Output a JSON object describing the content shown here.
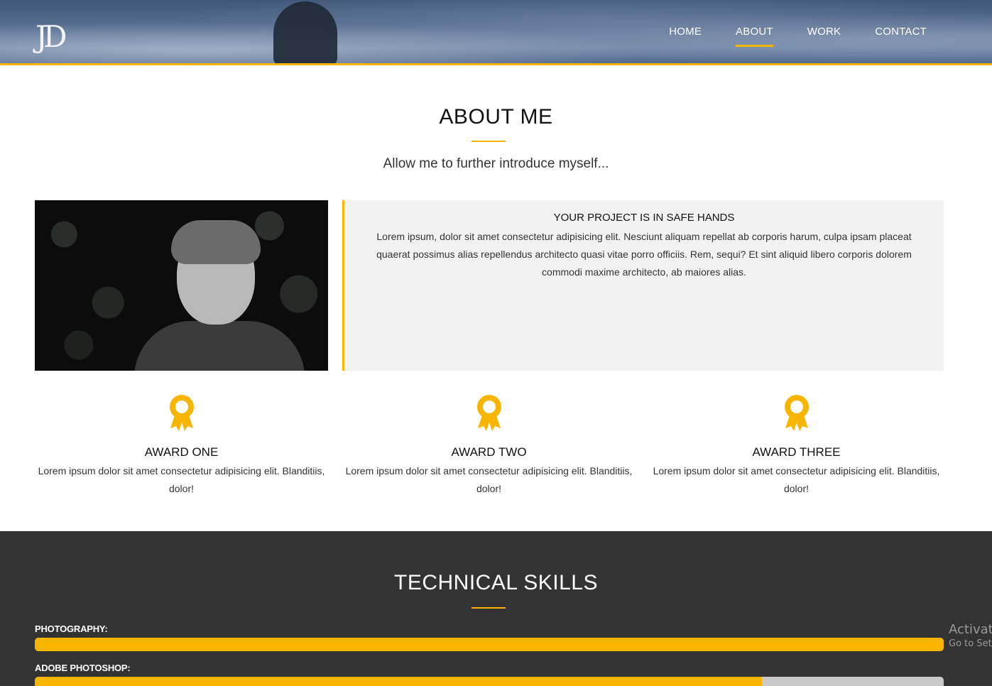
{
  "header": {
    "logo_text": "JD",
    "nav": [
      {
        "label": "HOME",
        "active": false
      },
      {
        "label": "ABOUT",
        "active": true
      },
      {
        "label": "WORK",
        "active": false
      },
      {
        "label": "CONTACT",
        "active": false
      }
    ],
    "accent_color": "#f7b500"
  },
  "about": {
    "title": "ABOUT ME",
    "subtitle": "Allow me to further introduce myself...",
    "card": {
      "title": "YOUR PROJECT IS IN SAFE HANDS",
      "text": "Lorem ipsum, dolor sit amet consectetur adipisicing elit. Nesciunt aliquam repellat ab corporis harum, culpa ipsam placeat quaerat possimus alias repellendus architecto quasi vitae porro officiis. Rem, sequi? Et sint aliquid libero corporis dolorem commodi maxime architecto, ab maiores alias."
    },
    "awards": [
      {
        "title": "AWARD ONE",
        "text": "Lorem ipsum dolor sit amet consectetur adipisicing elit. Blanditiis, dolor!",
        "icon": "award-ribbon-icon"
      },
      {
        "title": "AWARD TWO",
        "text": "Lorem ipsum dolor sit amet consectetur adipisicing elit. Blanditiis, dolor!",
        "icon": "award-ribbon-icon"
      },
      {
        "title": "AWARD THREE",
        "text": "Lorem ipsum dolor sit amet consectetur adipisicing elit. Blanditiis, dolor!",
        "icon": "award-ribbon-icon"
      }
    ]
  },
  "skills": {
    "title": "TECHNICAL SKILLS",
    "items": [
      {
        "label": "PHOTOGRAPHY:",
        "percent": 100
      },
      {
        "label": "ADOBE PHOTOSHOP:",
        "percent": 80
      }
    ]
  },
  "watermark": {
    "line1": "Activat",
    "line2": "Go to Set"
  }
}
